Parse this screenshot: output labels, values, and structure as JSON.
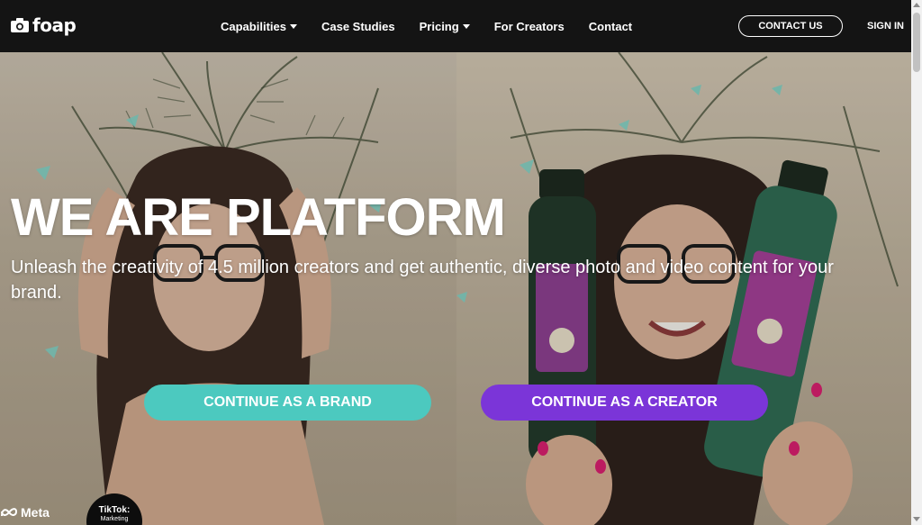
{
  "brand": {
    "name": "foap"
  },
  "nav": {
    "items": [
      {
        "label": "Capabilities",
        "dropdown": true
      },
      {
        "label": "Case Studies",
        "dropdown": false
      },
      {
        "label": "Pricing",
        "dropdown": true
      },
      {
        "label": "For Creators",
        "dropdown": false
      },
      {
        "label": "Contact",
        "dropdown": false
      }
    ],
    "contact_us": "CONTACT US",
    "sign_in": "SIGN IN"
  },
  "hero": {
    "title": "WE ARE  PLATFORM",
    "subtitle": "Unleash the creativity of 4.5 million creators and get authentic, diverse photo and video content for your brand.",
    "cta_brand": "CONTINUE AS A BRAND",
    "cta_creator": "CONTINUE AS A CREATOR"
  },
  "partners": {
    "meta": "Meta",
    "tiktok": "TikTok:",
    "tiktok_sub": "Marketing"
  },
  "colors": {
    "nav_bg": "#141414",
    "brand_teal": "#4cc9bf",
    "creator_purple": "#7b35d8",
    "text_white": "#ffffff"
  },
  "icons": [
    "camera-icon",
    "chevron-down-icon",
    "meta-logo-icon"
  ]
}
